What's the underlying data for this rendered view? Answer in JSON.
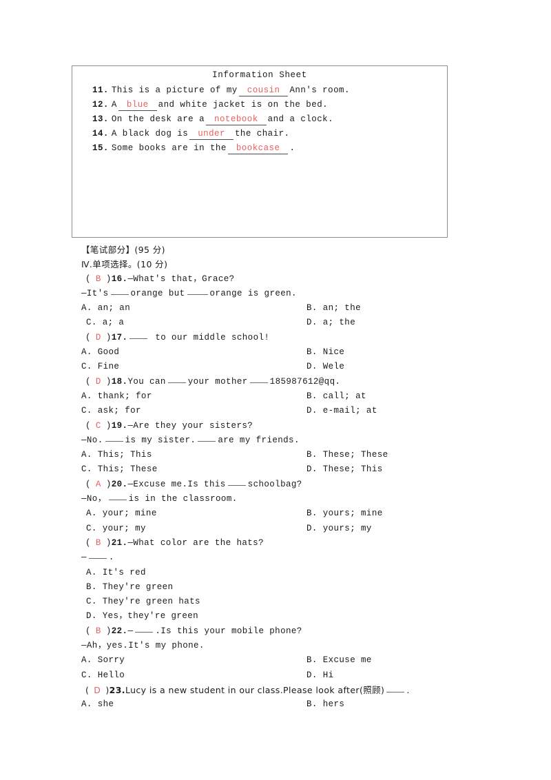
{
  "info_sheet": {
    "title": "Information Sheet",
    "items": [
      {
        "num": "11.",
        "pre": "This is a picture of my",
        "fill": "cousin",
        "post": "Ann's room."
      },
      {
        "num": "12.",
        "pre": "A",
        "fill": "blue",
        "post": "and white jacket is on the bed."
      },
      {
        "num": "13.",
        "pre": "On the desk are a",
        "fill": "notebook",
        "post": "and a clock."
      },
      {
        "num": "14.",
        "pre": "A black dog is",
        "fill": "under",
        "post": "the chair."
      },
      {
        "num": "15.",
        "pre": "Some books are in the",
        "fill": "bookcase",
        "post": "."
      }
    ]
  },
  "section": {
    "heading": "【笔试部分】(95 分)",
    "subheading": "Ⅳ.单项选择。(10 分)"
  },
  "questions": [
    {
      "answer": "B",
      "num": "16.",
      "stem": "—What's that，Grace?",
      "stem2_a": "—It's",
      "stem2_b": "orange but",
      "stem2_c": "orange is green.",
      "options": [
        {
          "left": "A. an; an",
          "right": "B. an; the"
        },
        {
          "left": "C. a; a",
          "right": "D. a; the"
        }
      ]
    },
    {
      "answer": "D",
      "num": "17.",
      "stem_after_blank": "to our middle school!",
      "options": [
        {
          "left": "A. Good",
          "right": "B. Nice"
        },
        {
          "left": "C. Fine",
          "right": "D. Wele"
        }
      ]
    },
    {
      "answer": "D",
      "num": "18.",
      "stem_a": "You can",
      "stem_b": "your mother",
      "stem_c": "185987612@qq.",
      "options": [
        {
          "left": "A. thank; for",
          "right": "B. call; at"
        },
        {
          "left": "C. ask; for",
          "right": "D. e-mail; at"
        }
      ]
    },
    {
      "answer": "C",
      "num": "19.",
      "stem": "—Are they your sisters?",
      "stem2_a": "—No.",
      "stem2_b": "is my sister.",
      "stem2_c": "are my friends.",
      "options": [
        {
          "left": "A. This; This",
          "right": "B. These; These"
        },
        {
          "left": "C. This; These",
          "right": "D. These; This"
        }
      ]
    },
    {
      "answer": "A",
      "num": "20.",
      "stem_a": "—Excuse me.Is this",
      "stem_b": "schoolbag?",
      "stem2_a": "—No，",
      "stem2_b": "is in the classroom.",
      "options": [
        {
          "left": "A. your; mine",
          "right": "B. yours; mine"
        },
        {
          "left": "C. your; my",
          "right": "D. yours; my"
        }
      ]
    },
    {
      "answer": "B",
      "num": "21.",
      "stem": "—What color are the hats?",
      "stem2_a": "—",
      "stem2_b": ".",
      "stacked_options": [
        "A. It's red",
        "B. They're green",
        "C. They're green hats",
        "D. Yes，they're green"
      ]
    },
    {
      "answer": "B",
      "num": "22.",
      "stem_a": "—",
      "stem_b": ".Is this your mobile phone?",
      "stem2": "—Ah，yes.It's my phone.",
      "options": [
        {
          "left": "A. Sorry",
          "right": "B. Excuse me"
        },
        {
          "left": "C. Hello",
          "right": "D. Hi"
        }
      ]
    },
    {
      "answer": "D",
      "num": "23.",
      "stem_a": "Lucy is a new student in our class.Please look after(照顾)",
      "stem_b": ".",
      "options": [
        {
          "left": "A. she",
          "right": "B. hers"
        }
      ]
    }
  ]
}
